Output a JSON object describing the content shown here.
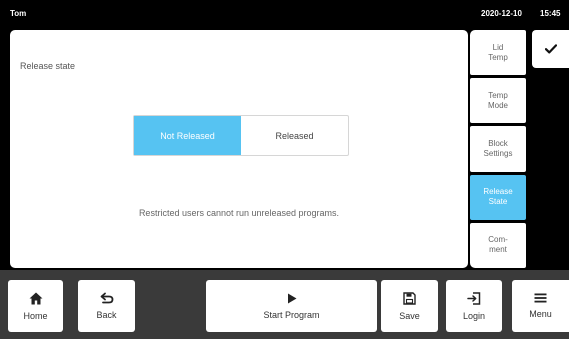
{
  "status_bar": {
    "user": "Tom",
    "date": "2020-12-10",
    "time": "15:45"
  },
  "panel": {
    "heading": "Release state",
    "options": [
      "Not Released",
      "Released"
    ],
    "selected": "Not Released",
    "note": "Restricted users cannot run unreleased programs."
  },
  "side_tabs": [
    {
      "label": "Lid\nTemp",
      "active": false
    },
    {
      "label": "Temp\nMode",
      "active": false
    },
    {
      "label": "Block\nSettings",
      "active": false
    },
    {
      "label": "Release\nState",
      "active": true
    },
    {
      "label": "Com-\nment",
      "active": false
    }
  ],
  "bottom_bar": {
    "home": "Home",
    "back": "Back",
    "start": "Start Program",
    "save": "Save",
    "login": "Login",
    "menu": "Menu"
  },
  "icons": {
    "confirm": "checkmark-icon",
    "home": "home-icon",
    "back": "back-arrow-icon",
    "start": "play-icon",
    "save": "floppy-disk-icon",
    "login": "login-icon",
    "menu": "hamburger-menu-icon"
  },
  "colors": {
    "accent": "#56c3f2",
    "background": "#000000",
    "bottom_bar": "#3a3a3a"
  }
}
